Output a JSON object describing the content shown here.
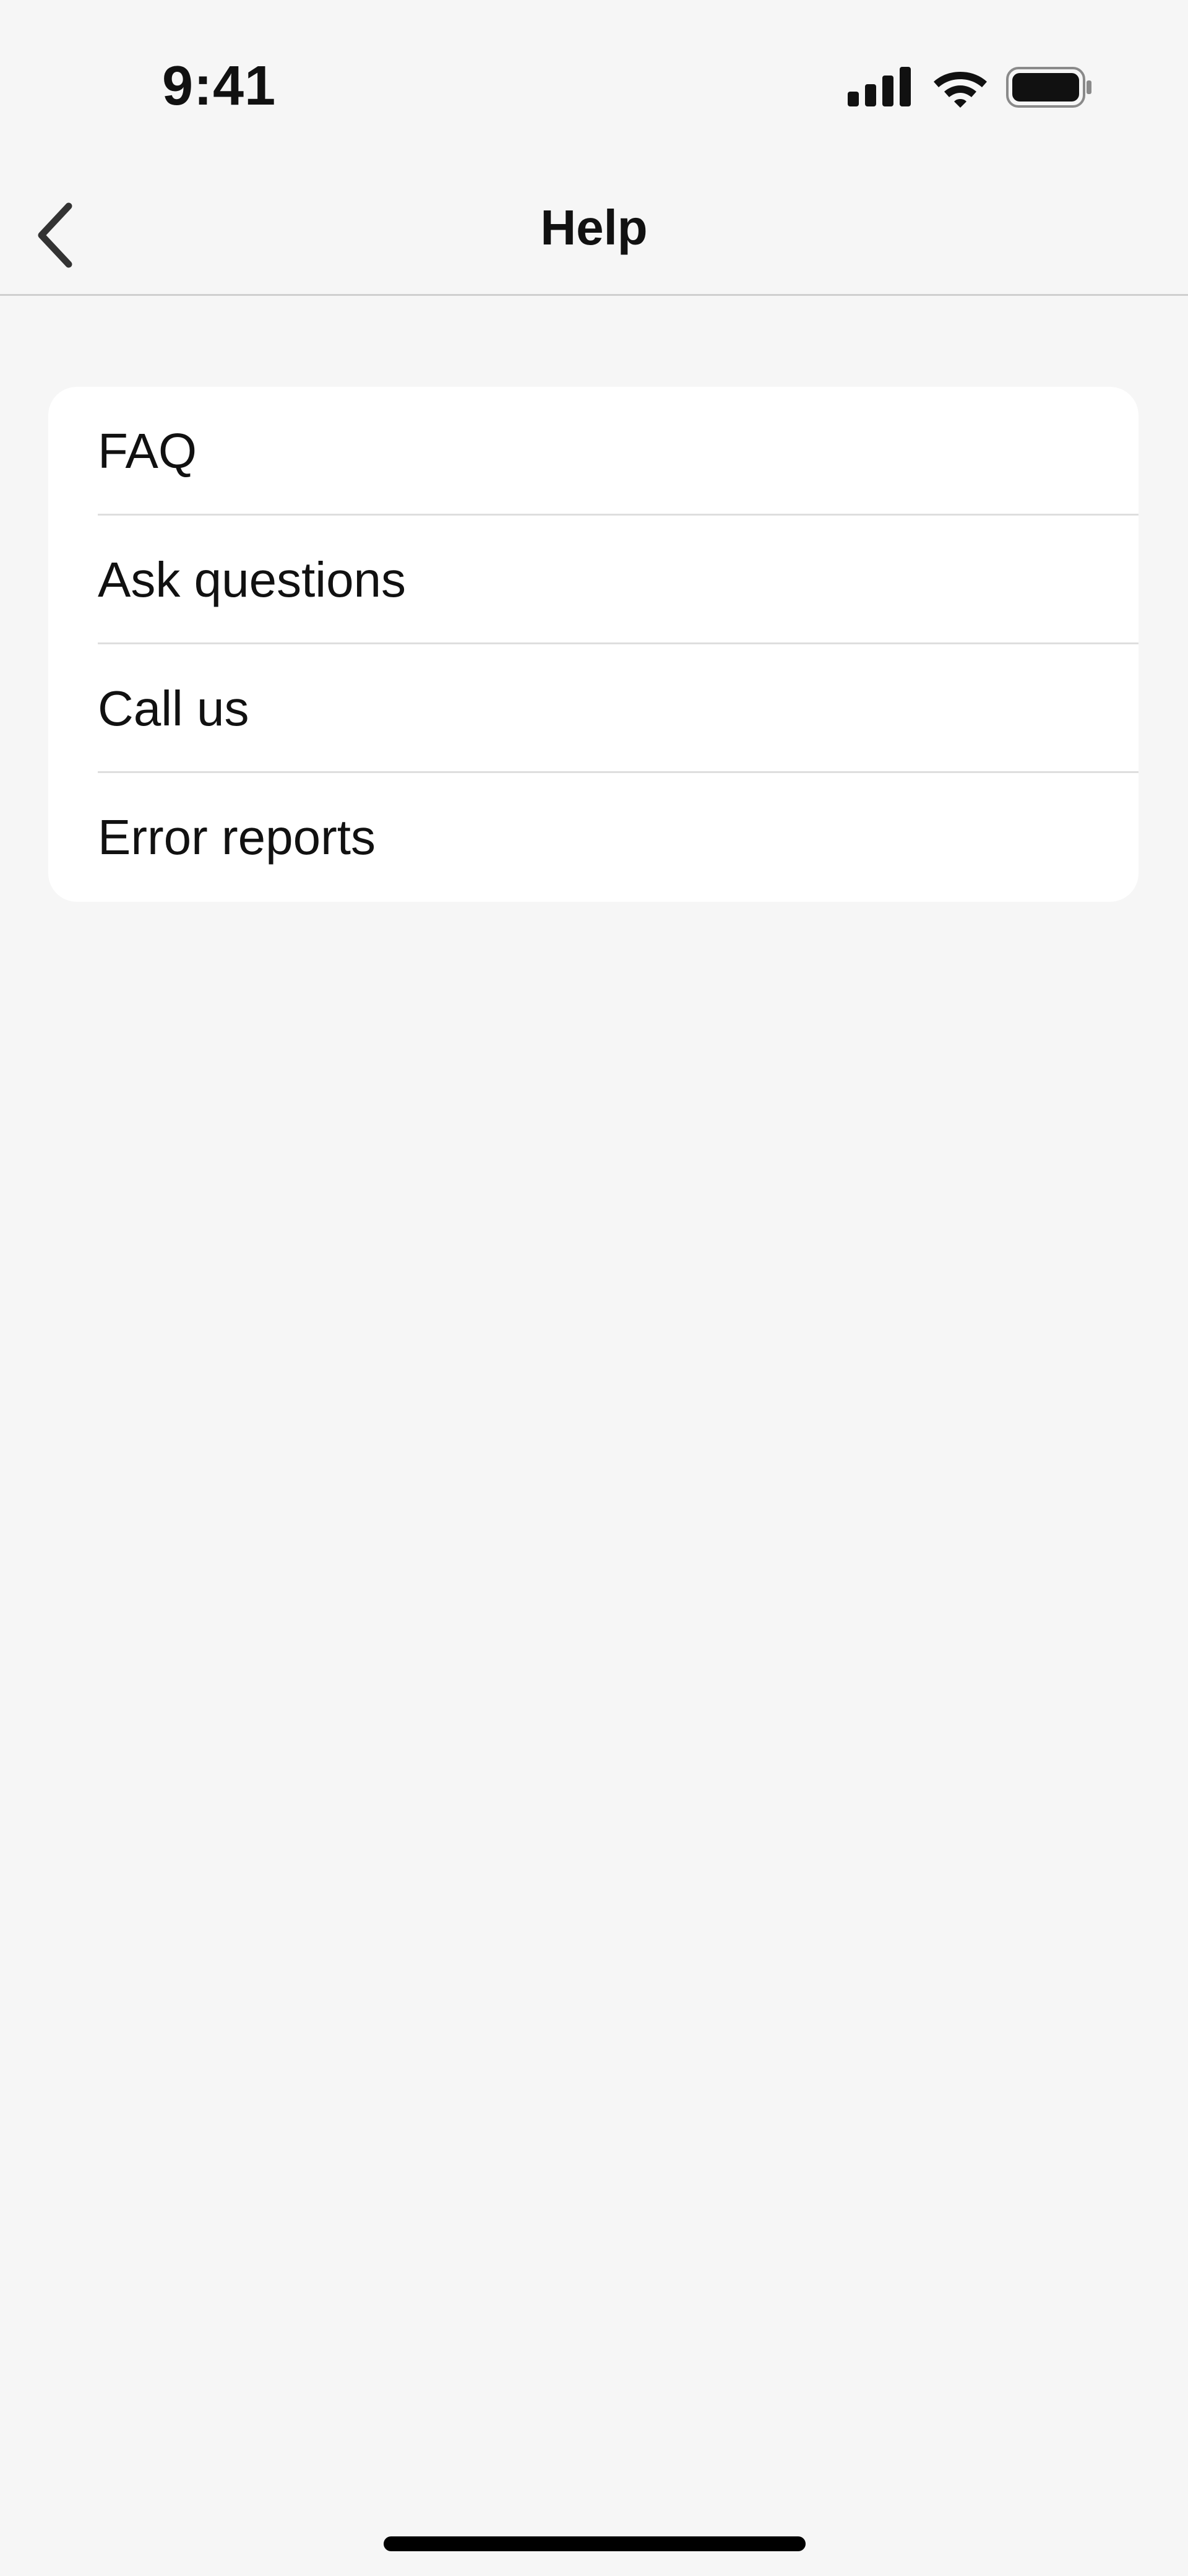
{
  "status_bar": {
    "time": "9:41",
    "icons": [
      "signal-icon",
      "wifi-icon",
      "battery-icon"
    ]
  },
  "nav": {
    "title": "Help",
    "back_icon": "chevron-left-icon"
  },
  "list": {
    "items": [
      {
        "label": "FAQ"
      },
      {
        "label": "Ask questions"
      },
      {
        "label": "Call us"
      },
      {
        "label": "Error reports"
      }
    ]
  },
  "colors": {
    "background": "#f6f6f6",
    "card": "#ffffff",
    "text": "#111111",
    "divider": "#dedede"
  }
}
